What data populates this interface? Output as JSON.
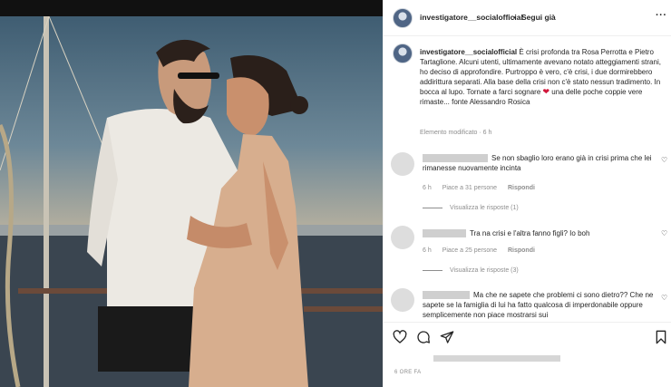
{
  "post": {
    "author": "investigatore__socialofficial",
    "dot": "•",
    "follow_label": "Segui già",
    "more": "···"
  },
  "caption": {
    "author": "investigatore__socialofficial",
    "text_before": "È crisi profonda tra Rosa Perrotta e Pietro Tartaglione. Alcuni utenti, ultimamente avevano notato atteggiamenti strani, ho deciso di approfondire. Purtroppo è vero, c'è crisi, i due dormirebbero addirittura separati. Alla base della crisi non c'è stato nessun tradimento. In bocca al lupo. Tornate a farci sognare",
    "text_after": "una delle poche coppie vere rimaste... fonte Alessandro Rosica",
    "meta": "Elemento modificato · 6 h"
  },
  "comments": [
    {
      "text": "Se non sbaglio loro erano già in crisi prima che lei rimanesse nuovamente incinta",
      "time": "6 h",
      "likes": "Piace a 31 persone",
      "reply": "Rispondi",
      "replies": "Visualizza le risposte (1)"
    },
    {
      "text": "Tra na crisi e l'altra fanno figli? Io boh",
      "time": "6 h",
      "likes": "Piace a 25 persone",
      "reply": "Rispondi",
      "replies": "Visualizza le risposte (3)"
    },
    {
      "text": "Ma che ne sapete che problemi ci sono dietro?? Che ne sapete se la famiglia di lui ha fatto qualcosa di imperdonabile oppure semplicemente non piace mostrarsi sui"
    }
  ],
  "footer": {
    "time": "6 ORE FA"
  },
  "colors": {
    "heart": "#d1163a",
    "muted": "#8e8e8e"
  },
  "icons": [
    "heart-icon",
    "comment-icon",
    "share-icon",
    "bookmark-icon"
  ]
}
